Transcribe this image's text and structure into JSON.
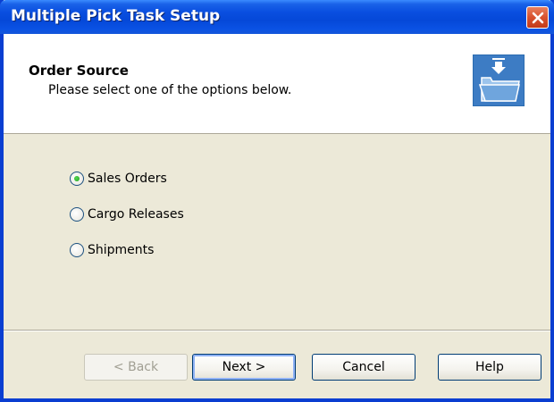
{
  "window": {
    "title": "Multiple Pick Task Setup"
  },
  "header": {
    "title": "Order Source",
    "subtitle": "Please  select one of the options below.",
    "icon": "folder-arrow-icon"
  },
  "options": {
    "items": [
      {
        "label": "Sales Orders",
        "checked": true
      },
      {
        "label": "Cargo Releases",
        "checked": false
      },
      {
        "label": "Shipments",
        "checked": false
      }
    ]
  },
  "buttons": {
    "back": "< Back",
    "next": "Next >",
    "cancel": "Cancel",
    "help": "Help"
  },
  "colors": {
    "titlebar": "#0A4FE0",
    "body": "#ECE9D8",
    "header": "#FFFFFF",
    "close": "#D8512E"
  }
}
